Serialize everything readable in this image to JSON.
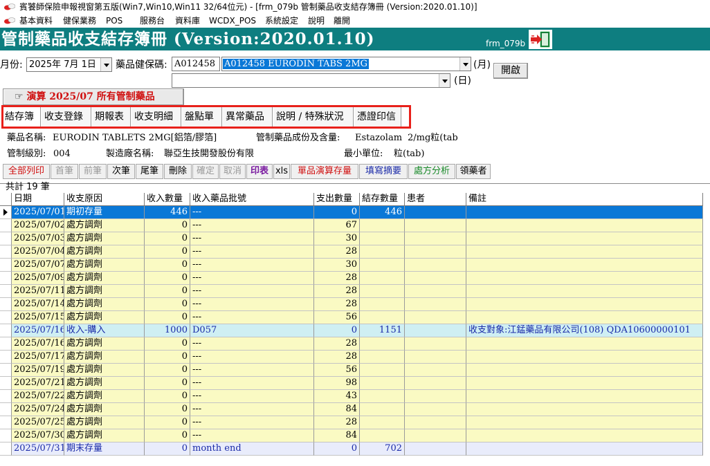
{
  "window": {
    "title": "賓饕師保險申報視窗第五版(Win7,Win10,Win11 32/64位元) - [frm_079b 管制藥品收支結存簿冊 (Version:2020.01.10)]"
  },
  "menu": [
    "基本資料",
    "健保業務",
    "POS",
    "服務台",
    "資料庫",
    "WCDX_POS",
    "系統設定",
    "說明",
    "離開"
  ],
  "header": {
    "title": "管制藥品收支結存簿冊 (Version:2020.01.10)",
    "form_name": "frm_079b"
  },
  "controls": {
    "month_label": "月份:",
    "month_value": "2025年  7月  1日",
    "drug_code_label": "藥品健保碼:",
    "drug_code_value": "A012458",
    "drug_select_value": "A012458 EURODIN TABS 2MG",
    "month_suffix": "(月)",
    "day_suffix": "(日)",
    "open_button": "開啟",
    "calc_button": "演算 2025/07 所有管制藥品"
  },
  "tabs": [
    "結存簿",
    "收支登錄",
    "期報表",
    "收支明細",
    "盤點單",
    "異常藥品",
    "說明 / 特殊狀況",
    "憑證印信"
  ],
  "info": {
    "drug_name_label": "藥品名稱:",
    "drug_name": "EURODIN TABLETS 2MG[鋁箔/膠箔]",
    "ingredient_label": "管制藥品成份及含量:",
    "ingredient": "Estazolam",
    "ingredient_amount": "2/mg粒(tab",
    "level_label": "管制級別:",
    "level": "004",
    "maker_label": "製造廠名稱:",
    "maker": "聯亞生技開發股份有限",
    "unit_label": "最小單位:",
    "unit": "粒(tab)"
  },
  "toolbar": [
    "全部列印",
    "首筆",
    "前筆",
    "次筆",
    "尾筆",
    "刪除",
    "確定",
    "取消",
    "印表",
    "xls",
    "單品演算存量",
    "填寫摘要",
    "處方分析",
    "領藥者"
  ],
  "count_label": "共計 19 筆",
  "grid": {
    "columns": [
      "日期",
      "收支原因",
      "收入數量",
      "收入藥品批號",
      "支出數量",
      "結存數量",
      "患者",
      "備註"
    ],
    "rows": [
      {
        "date": "2025/07/01",
        "reason": "期初存量",
        "in_qty": "446",
        "batch": "---",
        "out_qty": "0",
        "balance": "446",
        "patient": "",
        "note": ""
      },
      {
        "date": "2025/07/02",
        "reason": "處方調劑",
        "in_qty": "0",
        "batch": "---",
        "out_qty": "67",
        "balance": "",
        "patient": "",
        "note": ""
      },
      {
        "date": "2025/07/03",
        "reason": "處方調劑",
        "in_qty": "0",
        "batch": "---",
        "out_qty": "30",
        "balance": "",
        "patient": "",
        "note": ""
      },
      {
        "date": "2025/07/04",
        "reason": "處方調劑",
        "in_qty": "0",
        "batch": "---",
        "out_qty": "28",
        "balance": "",
        "patient": "",
        "note": ""
      },
      {
        "date": "2025/07/07",
        "reason": "處方調劑",
        "in_qty": "0",
        "batch": "---",
        "out_qty": "30",
        "balance": "",
        "patient": "",
        "note": ""
      },
      {
        "date": "2025/07/09",
        "reason": "處方調劑",
        "in_qty": "0",
        "batch": "---",
        "out_qty": "28",
        "balance": "",
        "patient": "",
        "note": ""
      },
      {
        "date": "2025/07/11",
        "reason": "處方調劑",
        "in_qty": "0",
        "batch": "---",
        "out_qty": "28",
        "balance": "",
        "patient": "",
        "note": ""
      },
      {
        "date": "2025/07/14",
        "reason": "處方調劑",
        "in_qty": "0",
        "batch": "---",
        "out_qty": "28",
        "balance": "",
        "patient": "",
        "note": ""
      },
      {
        "date": "2025/07/15",
        "reason": "處方調劑",
        "in_qty": "0",
        "batch": "---",
        "out_qty": "56",
        "balance": "",
        "patient": "",
        "note": ""
      },
      {
        "date": "2025/07/16",
        "reason": "收入-購入",
        "in_qty": "1000",
        "batch": "D057",
        "out_qty": "0",
        "balance": "1151",
        "patient": "",
        "note": "收支對象:江錳藥品有限公司(108) QDA10600000101"
      },
      {
        "date": "2025/07/16",
        "reason": "處方調劑",
        "in_qty": "0",
        "batch": "---",
        "out_qty": "28",
        "balance": "",
        "patient": "",
        "note": ""
      },
      {
        "date": "2025/07/17",
        "reason": "處方調劑",
        "in_qty": "0",
        "batch": "---",
        "out_qty": "28",
        "balance": "",
        "patient": "",
        "note": ""
      },
      {
        "date": "2025/07/19",
        "reason": "處方調劑",
        "in_qty": "0",
        "batch": "---",
        "out_qty": "56",
        "balance": "",
        "patient": "",
        "note": ""
      },
      {
        "date": "2025/07/21",
        "reason": "處方調劑",
        "in_qty": "0",
        "batch": "---",
        "out_qty": "98",
        "balance": "",
        "patient": "",
        "note": ""
      },
      {
        "date": "2025/07/22",
        "reason": "處方調劑",
        "in_qty": "0",
        "batch": "---",
        "out_qty": "43",
        "balance": "",
        "patient": "",
        "note": ""
      },
      {
        "date": "2025/07/24",
        "reason": "處方調劑",
        "in_qty": "0",
        "batch": "---",
        "out_qty": "84",
        "balance": "",
        "patient": "",
        "note": ""
      },
      {
        "date": "2025/07/25",
        "reason": "處方調劑",
        "in_qty": "0",
        "batch": "---",
        "out_qty": "28",
        "balance": "",
        "patient": "",
        "note": ""
      },
      {
        "date": "2025/07/30",
        "reason": "處方調劑",
        "in_qty": "0",
        "batch": "---",
        "out_qty": "84",
        "balance": "",
        "patient": "",
        "note": ""
      },
      {
        "date": "2025/07/31",
        "reason": "期末存量",
        "in_qty": "0",
        "batch": "month end",
        "out_qty": "0",
        "balance": "702",
        "patient": "",
        "note": ""
      }
    ]
  },
  "colors": {
    "header_bg": "#0e7e80",
    "selected_row": "#0a78d7",
    "normal_row": "#fafac3",
    "purchase_row": "#cfeff3",
    "end_row": "#e9ecfb",
    "tab_highlight": "#e8201a"
  }
}
